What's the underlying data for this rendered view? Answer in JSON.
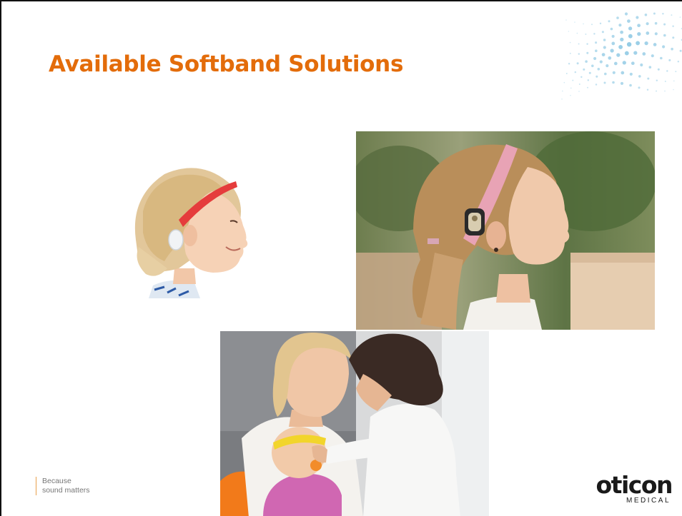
{
  "slide": {
    "title": "Available Softband Solutions"
  },
  "images": {
    "boy": "boy-red-softband-photo",
    "girl": "girl-pink-softband-photo",
    "baby": "baby-yellow-softband-photo"
  },
  "footer": {
    "tagline_line1": "Because",
    "tagline_line2": "sound matters",
    "logo_name": "oticon",
    "logo_sub": "MEDICAL"
  },
  "colors": {
    "title": "#e36c0a",
    "dots": "#8fc9e4",
    "tagline_rule": "#e9a04d",
    "softband_red": "#e53c3c",
    "softband_pink": "#e8a3b5",
    "softband_yellow": "#f2d52b"
  }
}
